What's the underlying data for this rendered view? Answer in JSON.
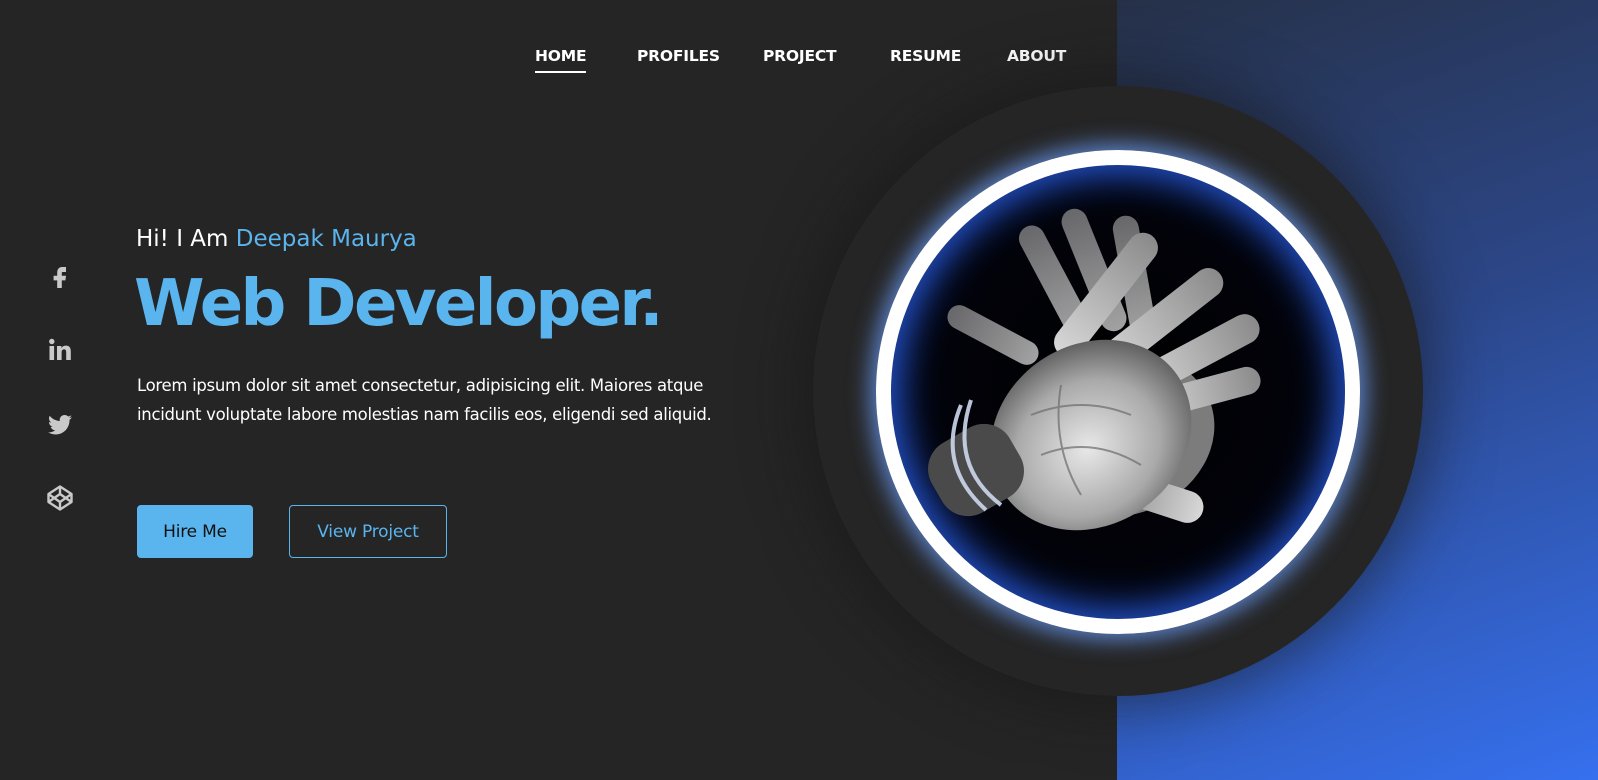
{
  "nav": {
    "items": [
      {
        "label": "HOME",
        "active": true
      },
      {
        "label": "PROFILES",
        "active": false
      },
      {
        "label": "PROJECT",
        "active": false
      },
      {
        "label": "RESUME",
        "active": false
      },
      {
        "label": "ABOUT",
        "active": false
      }
    ]
  },
  "social": {
    "icons": [
      "facebook-icon",
      "linkedin-icon",
      "twitter-icon",
      "codepen-icon"
    ]
  },
  "hero": {
    "greeting_prefix": "Hi! I Am",
    "name": "Deepak Maurya",
    "headline": "Web Developer.",
    "intro": "Lorem ipsum dolor sit amet consectetur, adipisicing elit. Maiores atque incidunt voluptate labore molestias nam facilis eos, eligendi sed aliquid.",
    "hire_label": "Hire Me",
    "view_label": "View Project",
    "image_icon": "hands-photo"
  },
  "colors": {
    "background": "#252525",
    "accent": "#5ab4ee",
    "text": "#ffffff",
    "panel_gradient_start": "#263148",
    "panel_gradient_end": "#3670ef"
  }
}
